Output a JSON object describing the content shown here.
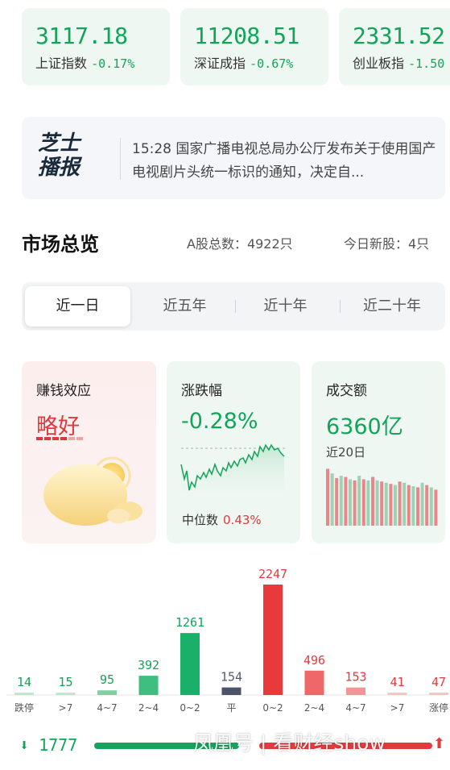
{
  "indices": [
    {
      "value": "3117.18",
      "name": "上证指数",
      "change": "-0.17%"
    },
    {
      "value": "11208.51",
      "name": "深证成指",
      "change": "-0.67%"
    },
    {
      "value": "2331.52",
      "name": "创业板指",
      "change": "-1.50"
    }
  ],
  "news": {
    "logo_line1": "芝士",
    "logo_line2": "播报",
    "text": "15:28 国家广播电视总局办公厅发布关于使用国产电视剧片头统一标识的通知，决定自..."
  },
  "market": {
    "title": "市场总览",
    "total_label": "A股总数：4922只",
    "new_label": "今日新股：4只"
  },
  "tabs": [
    "近一日",
    "近五年",
    "近十年",
    "近二十年"
  ],
  "tab_active": 0,
  "cards": {
    "sentiment": {
      "title": "赚钱效应",
      "value": "略好"
    },
    "change": {
      "title": "涨跌幅",
      "value": "-0.28%",
      "median_label": "中位数",
      "median_value": "0.43%"
    },
    "volume": {
      "title": "成交额",
      "value": "6360亿",
      "sub": "近20日"
    }
  },
  "chart_data": {
    "type": "bar",
    "categories": [
      "跌停",
      ">7",
      "4~7",
      "2~4",
      "0~2",
      "平",
      "0~2",
      "2~4",
      "4~7",
      ">7",
      "涨停"
    ],
    "values": [
      14,
      15,
      95,
      392,
      1261,
      154,
      2247,
      496,
      153,
      41,
      47
    ],
    "colors": [
      "#14a35a",
      "#14a35a",
      "#14a35a",
      "#14a35a",
      "#14a35a",
      "#555b6e",
      "#e23b3d",
      "#e23b3d",
      "#e23b3d",
      "#e23b3d",
      "#e23b3d"
    ],
    "value_label_colors": [
      "#14a35a",
      "#14a35a",
      "#14a35a",
      "#14a35a",
      "#14a35a",
      "#555b6e",
      "#e23b3d",
      "#e23b3d",
      "#e23b3d",
      "#e23b3d",
      "#e23b3d"
    ],
    "bar_colors": [
      "#bfe6cf",
      "#bfe6cf",
      "#7fd1a4",
      "#3fbf7f",
      "#19b06a",
      "#4d5468",
      "#e8393c",
      "#ef6768",
      "#f39596",
      "#f8c3c3",
      "#f8c3c3"
    ],
    "ylim": [
      0,
      2247
    ]
  },
  "summary": {
    "down_count": "1777",
    "watermark": "凤凰号 | 看财经show"
  },
  "colors": {
    "green": "#14a35a",
    "red": "#e23b3d",
    "card_bg": "#eef7f1"
  }
}
